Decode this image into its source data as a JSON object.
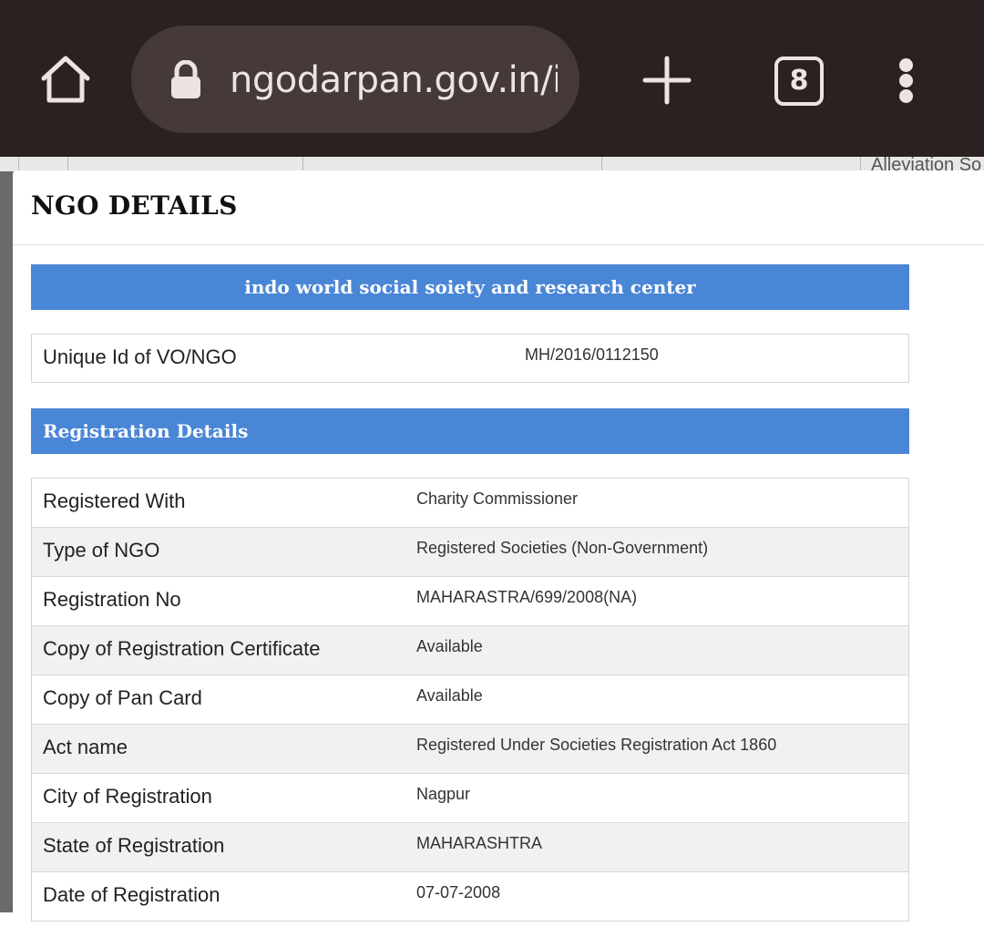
{
  "browser": {
    "url": "ngodarpan.gov.in/index.php",
    "tab_count": "8",
    "icons": {
      "home": "home-icon",
      "lock": "lock-icon",
      "new_tab": "plus-icon",
      "tabs": "tab-switcher-icon",
      "menu": "more-vert-icon"
    },
    "colors": {
      "toolbar": "#2a2120",
      "url_pill": "#453a39",
      "foreground": "#ece4e2"
    }
  },
  "background_page": {
    "partial_text": "Alleviation So"
  },
  "modal": {
    "title": "NGO DETAILS",
    "org_name": "indo world social soiety and research center",
    "unique_id": {
      "label": "Unique Id of VO/NGO",
      "value": "MH/2016/0112150"
    },
    "registration_header": "Registration Details",
    "registration_rows": [
      {
        "label": "Registered With",
        "value": "Charity Commissioner"
      },
      {
        "label": "Type of NGO",
        "value": "Registered Societies (Non-Government)"
      },
      {
        "label": "Registration No",
        "value": "MAHARASTRA/699/2008(NA)"
      },
      {
        "label": "Copy of Registration Certificate",
        "value": "Available"
      },
      {
        "label": "Copy of Pan Card",
        "value": "Available"
      },
      {
        "label": "Act name",
        "value": "Registered Under Societies Registration Act 1860"
      },
      {
        "label": "City of Registration",
        "value": "Nagpur"
      },
      {
        "label": "State of Registration",
        "value": "MAHARASHTRA"
      },
      {
        "label": "Date of Registration",
        "value": "07-07-2008"
      }
    ],
    "colors": {
      "header_bar": "#4a86d6",
      "alt_row": "#f1f1f1"
    }
  }
}
